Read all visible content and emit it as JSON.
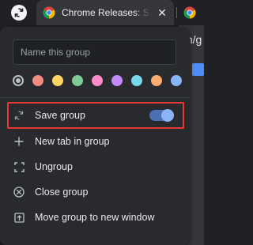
{
  "tabstrip": {
    "tab_title": "Chrome Releases: Stable",
    "tab_close": "✕"
  },
  "background": {
    "url_fragment": "m/g"
  },
  "menu": {
    "name_input": {
      "value": "",
      "placeholder": "Name this group"
    },
    "colors": [
      {
        "name": "grey",
        "hex": "#bdc1c6",
        "selected": true
      },
      {
        "name": "red",
        "hex": "#f28b82"
      },
      {
        "name": "yellow",
        "hex": "#fdd663"
      },
      {
        "name": "green",
        "hex": "#81c995"
      },
      {
        "name": "pink",
        "hex": "#ff8bcb"
      },
      {
        "name": "purple",
        "hex": "#c58af9"
      },
      {
        "name": "cyan",
        "hex": "#78d9ec"
      },
      {
        "name": "orange",
        "hex": "#fcad70"
      },
      {
        "name": "blue",
        "hex": "#8ab4f8"
      }
    ],
    "items": {
      "save_group": {
        "label": "Save group",
        "toggle_on": true
      },
      "new_tab": {
        "label": "New tab in group"
      },
      "ungroup": {
        "label": "Ungroup"
      },
      "close_group": {
        "label": "Close group"
      },
      "move_group": {
        "label": "Move group to new window"
      }
    }
  },
  "colors": {
    "accent": "#8ab4f8",
    "highlight_border": "#e53935"
  }
}
